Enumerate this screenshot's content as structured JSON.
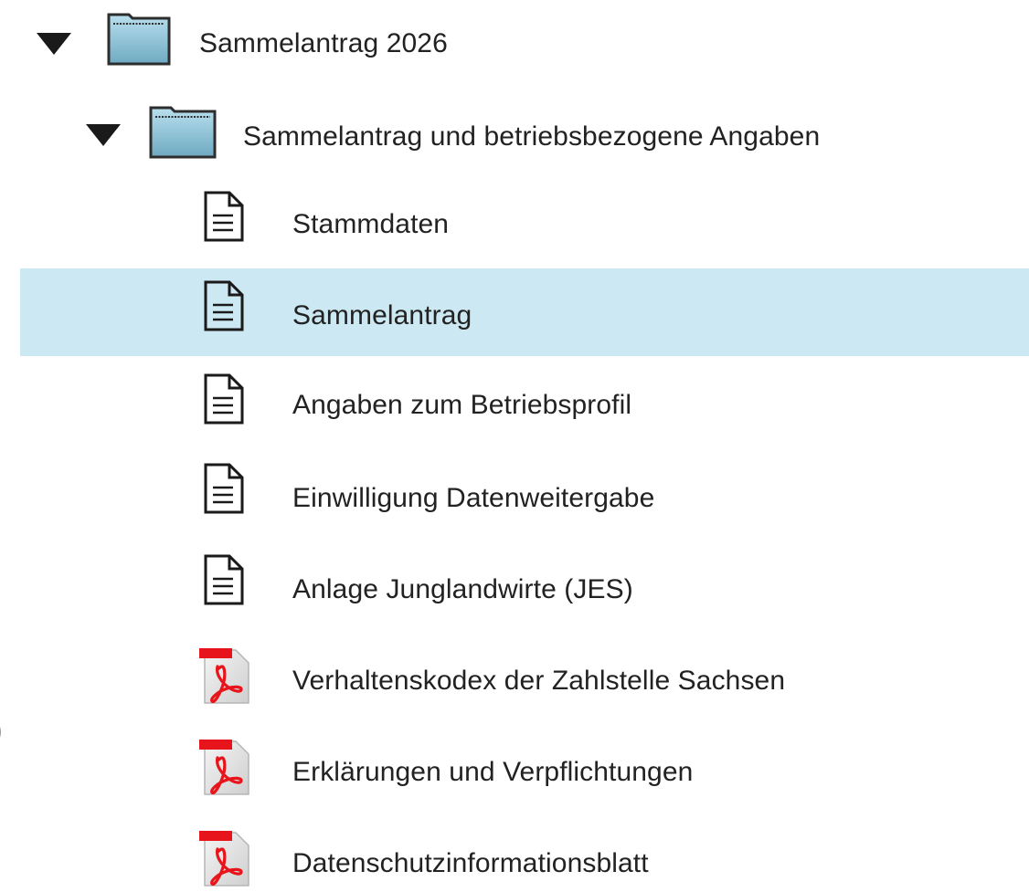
{
  "tree": {
    "root": {
      "label": "Sammelantrag 2026",
      "expanded": true,
      "icon": "folder-icon"
    },
    "subfolder": {
      "label": "Sammelantrag und betriebsbezogene Angaben",
      "expanded": true,
      "icon": "folder-icon"
    },
    "items": [
      {
        "label": "Stammdaten",
        "icon": "document-icon",
        "selected": false
      },
      {
        "label": "Sammelantrag",
        "icon": "document-icon",
        "selected": true
      },
      {
        "label": "Angaben zum Betriebsprofil",
        "icon": "document-icon",
        "selected": false
      },
      {
        "label": "Einwilligung Datenweitergabe",
        "icon": "document-icon",
        "selected": false
      },
      {
        "label": "Anlage Junglandwirte (JES)",
        "icon": "document-icon",
        "selected": false
      },
      {
        "label": "Verhaltenskodex der Zahlstelle Sachsen",
        "icon": "pdf-icon",
        "selected": false
      },
      {
        "label": "Erklärungen und Verpflichtungen",
        "icon": "pdf-icon",
        "selected": false
      },
      {
        "label": "Datenschutzinformationsblatt",
        "icon": "pdf-icon",
        "selected": false
      }
    ]
  },
  "edge_fragment": ")",
  "colors": {
    "selection": "#cce8f2",
    "folder": "#8cc4d8",
    "pdf_red": "#e8141b"
  }
}
